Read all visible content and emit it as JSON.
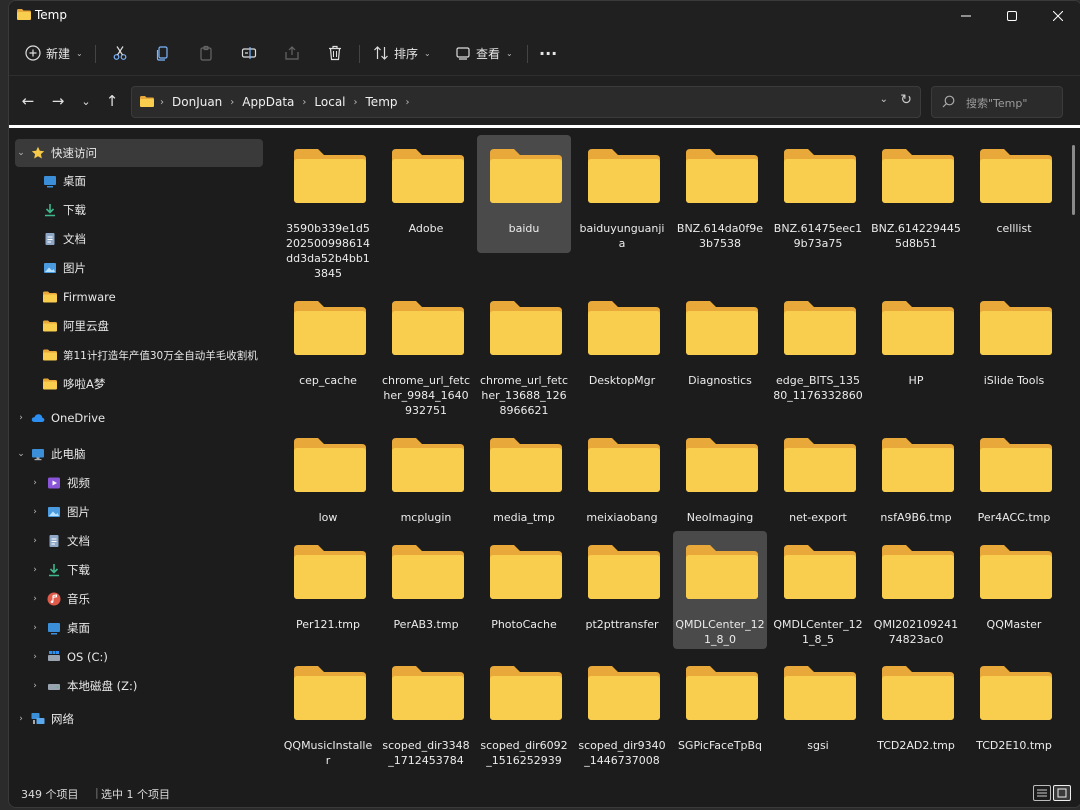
{
  "window": {
    "title": "Temp"
  },
  "toolbar": {
    "new_label": "新建",
    "sort_label": "排序",
    "view_label": "查看",
    "more_label": "···"
  },
  "address": {
    "crumbs": [
      "DonJuan",
      "AppData",
      "Local",
      "Temp"
    ]
  },
  "search": {
    "placeholder": "搜索\"Temp\""
  },
  "sidebar": {
    "quick_access": "快速访问",
    "quick_items": [
      "桌面",
      "下载",
      "文档",
      "图片",
      "Firmware",
      "阿里云盘",
      "第11计打造年产值30万全自动羊毛收割机",
      "哆啦A梦"
    ],
    "onedrive": "OneDrive",
    "this_pc": "此电脑",
    "pc_items": [
      "视频",
      "图片",
      "文档",
      "下载",
      "音乐",
      "桌面",
      "OS (C:)",
      "本地磁盘 (Z:)"
    ],
    "network": "网络"
  },
  "folders": [
    "3590b339e1d5202500998614dd3da52b4bb13845",
    "Adobe",
    "baidu",
    "baiduyunguanjia",
    "BNZ.614da0f9e3b7538",
    "BNZ.61475eec19b73a75",
    "BNZ.6142294455d8b51",
    "celllist",
    "cep_cache",
    "chrome_url_fetcher_9984_1640932751",
    "chrome_url_fetcher_13688_1268966621",
    "DesktopMgr",
    "Diagnostics",
    "edge_BITS_13580_1176332860",
    "HP",
    "iSlide Tools",
    "low",
    "mcplugin",
    "media_tmp",
    "meixiaobang",
    "NeoImaging",
    "net-export",
    "nsfA9B6.tmp",
    "Per4ACC.tmp",
    "Per121.tmp",
    "PerAB3.tmp",
    "PhotoCache",
    "pt2pttransfer",
    "QMDLCenter_121_8_0",
    "QMDLCenter_121_8_5",
    "QMI20210924174823ac0",
    "QQMaster",
    "QQMusicInstaller",
    "scoped_dir3348_1712453784",
    "scoped_dir6092_1516252939",
    "scoped_dir9340_1446737008",
    "SGPicFaceTpBq",
    "sgsi",
    "TCD2AD2.tmp",
    "TCD2E10.tmp"
  ],
  "selected_folders": [
    "baidu",
    "QMDLCenter_121_8_0"
  ],
  "status": {
    "count": "349 个项目",
    "selected": "选中 1 个项目"
  },
  "colors": {
    "folder_front": "#f9cd4d",
    "folder_back": "#e8a93a",
    "selection": "#4a4a4a",
    "window_bg": "#1c1c1c"
  }
}
